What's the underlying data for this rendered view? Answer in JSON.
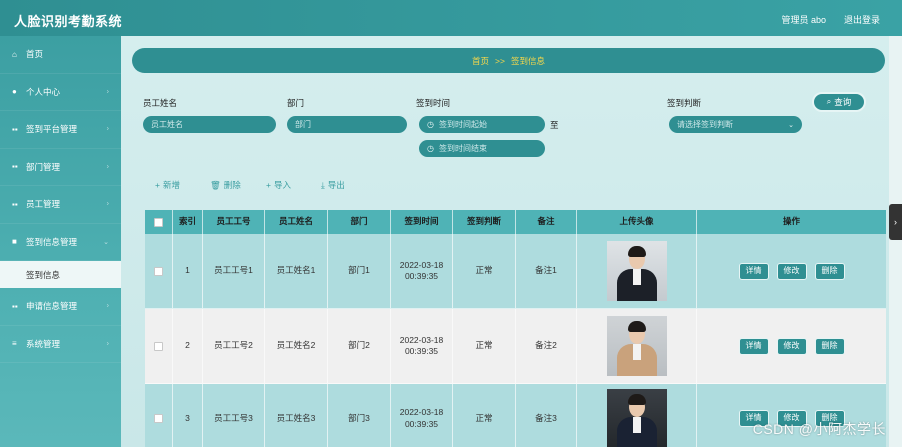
{
  "app": {
    "title": "人脸识别考勤系统",
    "admin": "管理员 abo",
    "logout": "退出登录"
  },
  "sidebar": {
    "items": [
      {
        "label": "首页",
        "icon": "home-icon",
        "glyph": "⌂"
      },
      {
        "label": "个人中心",
        "icon": "user-icon",
        "glyph": "●"
      },
      {
        "label": "签到平台管理",
        "icon": "grid-icon",
        "glyph": "▪▪"
      },
      {
        "label": "部门管理",
        "icon": "grid-icon",
        "glyph": "▪▪"
      },
      {
        "label": "员工管理",
        "icon": "grid-icon",
        "glyph": "▪▪"
      },
      {
        "label": "签到信息管理",
        "icon": "folder-icon",
        "glyph": "■"
      },
      {
        "label": "签到信息",
        "icon": "",
        "glyph": ""
      },
      {
        "label": "申请信息管理",
        "icon": "grid-icon",
        "glyph": "▪▪"
      },
      {
        "label": "系统管理",
        "icon": "list-icon",
        "glyph": "≡"
      }
    ]
  },
  "breadcrumb": {
    "home": "首页",
    "sep": ">>",
    "current": "签到信息"
  },
  "filters": {
    "name_label": "员工姓名",
    "name_placeholder": "员工姓名",
    "dept_label": "部门",
    "dept_placeholder": "部门",
    "time_label": "签到时间",
    "time_start": "签到时间起始",
    "time_end": "签到时间结束",
    "tilde": "至",
    "judge_label": "签到判断",
    "judge_placeholder": "请选择签到判断",
    "search": "查询"
  },
  "actions": {
    "add": "新增",
    "delete": "删除",
    "import": "导入",
    "export": "导出"
  },
  "table": {
    "headers": [
      "",
      "索引",
      "员工工号",
      "员工姓名",
      "部门",
      "签到时间",
      "签到判断",
      "备注",
      "上传头像",
      "操作"
    ],
    "rows": [
      {
        "index": "1",
        "emp_no": "员工工号1",
        "name": "员工姓名1",
        "dept": "部门1",
        "date": "2022-03-18",
        "time": "00:39:35",
        "judge": "正常",
        "note": "备注1"
      },
      {
        "index": "2",
        "emp_no": "员工工号2",
        "name": "员工姓名2",
        "dept": "部门2",
        "date": "2022-03-18",
        "time": "00:39:35",
        "judge": "正常",
        "note": "备注2"
      },
      {
        "index": "3",
        "emp_no": "员工工号3",
        "name": "员工姓名3",
        "dept": "部门3",
        "date": "2022-03-18",
        "time": "00:39:35",
        "judge": "正常",
        "note": "备注3"
      }
    ],
    "ops": {
      "detail": "详情",
      "edit": "修改",
      "delete": "删除"
    }
  },
  "watermark": "CSDN @小阿杰学长",
  "colors": {
    "primary": "#2f8f92",
    "accent": "#f7d84a",
    "header_row": "#4fb3b6"
  }
}
